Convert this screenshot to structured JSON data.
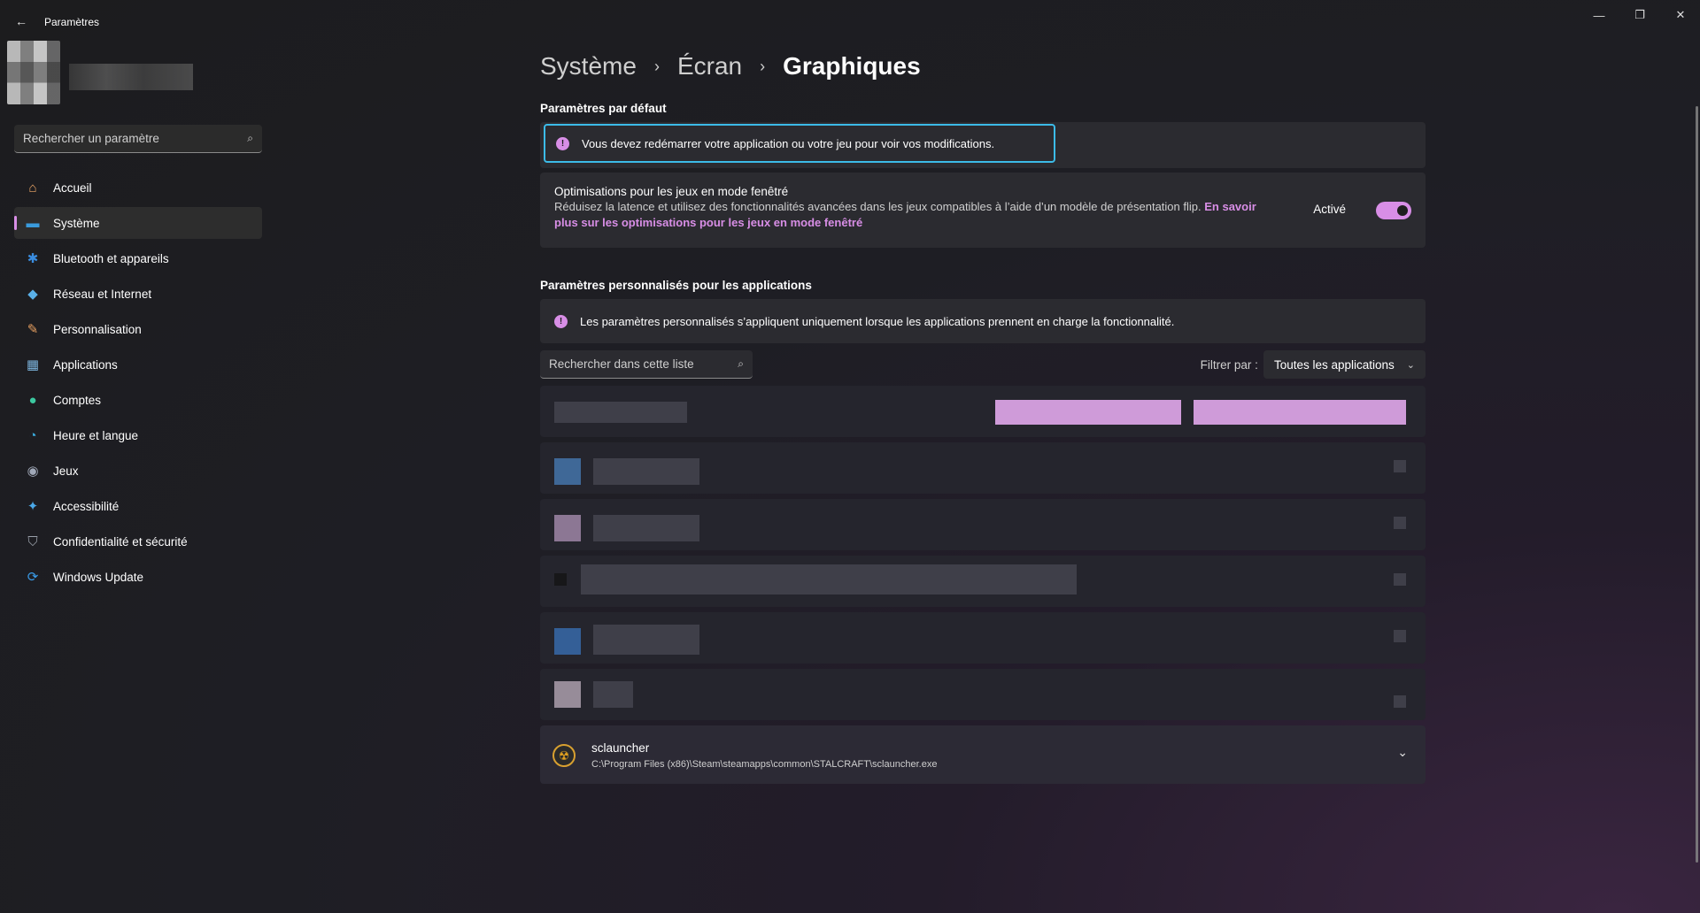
{
  "window": {
    "title": "Paramètres",
    "minimize_glyph": "—",
    "maximize_glyph": "❐",
    "close_glyph": "✕"
  },
  "sidebar": {
    "search_placeholder": "Rechercher un paramètre",
    "items": [
      {
        "label": "Accueil",
        "icon": "home-icon",
        "glyph": "⌂",
        "color": "#f0a868"
      },
      {
        "label": "Système",
        "icon": "display-icon",
        "glyph": "▬",
        "color": "#3a9bdc"
      },
      {
        "label": "Bluetooth et appareils",
        "icon": "bluetooth-icon",
        "glyph": "✱",
        "color": "#3a8de0"
      },
      {
        "label": "Réseau et Internet",
        "icon": "wifi-icon",
        "glyph": "◆",
        "color": "#5ab0e8"
      },
      {
        "label": "Personnalisation",
        "icon": "brush-icon",
        "glyph": "✎",
        "color": "#e8a060"
      },
      {
        "label": "Applications",
        "icon": "apps-icon",
        "glyph": "▦",
        "color": "#7ab0d8"
      },
      {
        "label": "Comptes",
        "icon": "person-icon",
        "glyph": "●",
        "color": "#3cc8a0"
      },
      {
        "label": "Heure et langue",
        "icon": "globe-clock-icon",
        "glyph": "◔",
        "color": "#3aa8d8"
      },
      {
        "label": "Jeux",
        "icon": "gamepad-icon",
        "glyph": "◉",
        "color": "#a0a8b8"
      },
      {
        "label": "Accessibilité",
        "icon": "accessibility-icon",
        "glyph": "✦",
        "color": "#4aa8e8"
      },
      {
        "label": "Confidentialité et sécurité",
        "icon": "shield-icon",
        "glyph": "⛉",
        "color": "#9aa0aa"
      },
      {
        "label": "Windows Update",
        "icon": "update-icon",
        "glyph": "⟳",
        "color": "#3a9be8"
      }
    ],
    "active_index": 1
  },
  "breadcrumb": {
    "items": [
      "Système",
      "Écran",
      "Graphiques"
    ],
    "separator": "›"
  },
  "defaults": {
    "title": "Paramètres par défaut",
    "restart_notice": "Vous devez redémarrer votre application ou votre jeu pour voir vos modifications.",
    "windowed_opt": {
      "title": "Optimisations pour les jeux en mode fenêtré",
      "description": "Réduisez la latence et utilisez des fonctionnalités avancées dans les jeux compatibles à l’aide d’un modèle de présentation flip.",
      "link_text": "En savoir plus sur les optimisations pour les jeux en mode fenêtré",
      "status": "Activé",
      "enabled": true
    }
  },
  "custom": {
    "title": "Paramètres personnalisés pour les applications",
    "notice": "Les paramètres personnalisés s’appliquent uniquement lorsque les applications prennent en charge la fonctionnalité.",
    "search_placeholder": "Rechercher dans cette liste",
    "filter_label": "Filtrer par :",
    "filter_value": "Toutes les applications",
    "last_app": {
      "name": "sclauncher",
      "path": "C:\\Program Files (x86)\\Steam\\steamapps\\common\\STALCRAFT\\sclauncher.exe"
    }
  },
  "accent": "#d88ee6",
  "focus_color": "#3cbbe8"
}
